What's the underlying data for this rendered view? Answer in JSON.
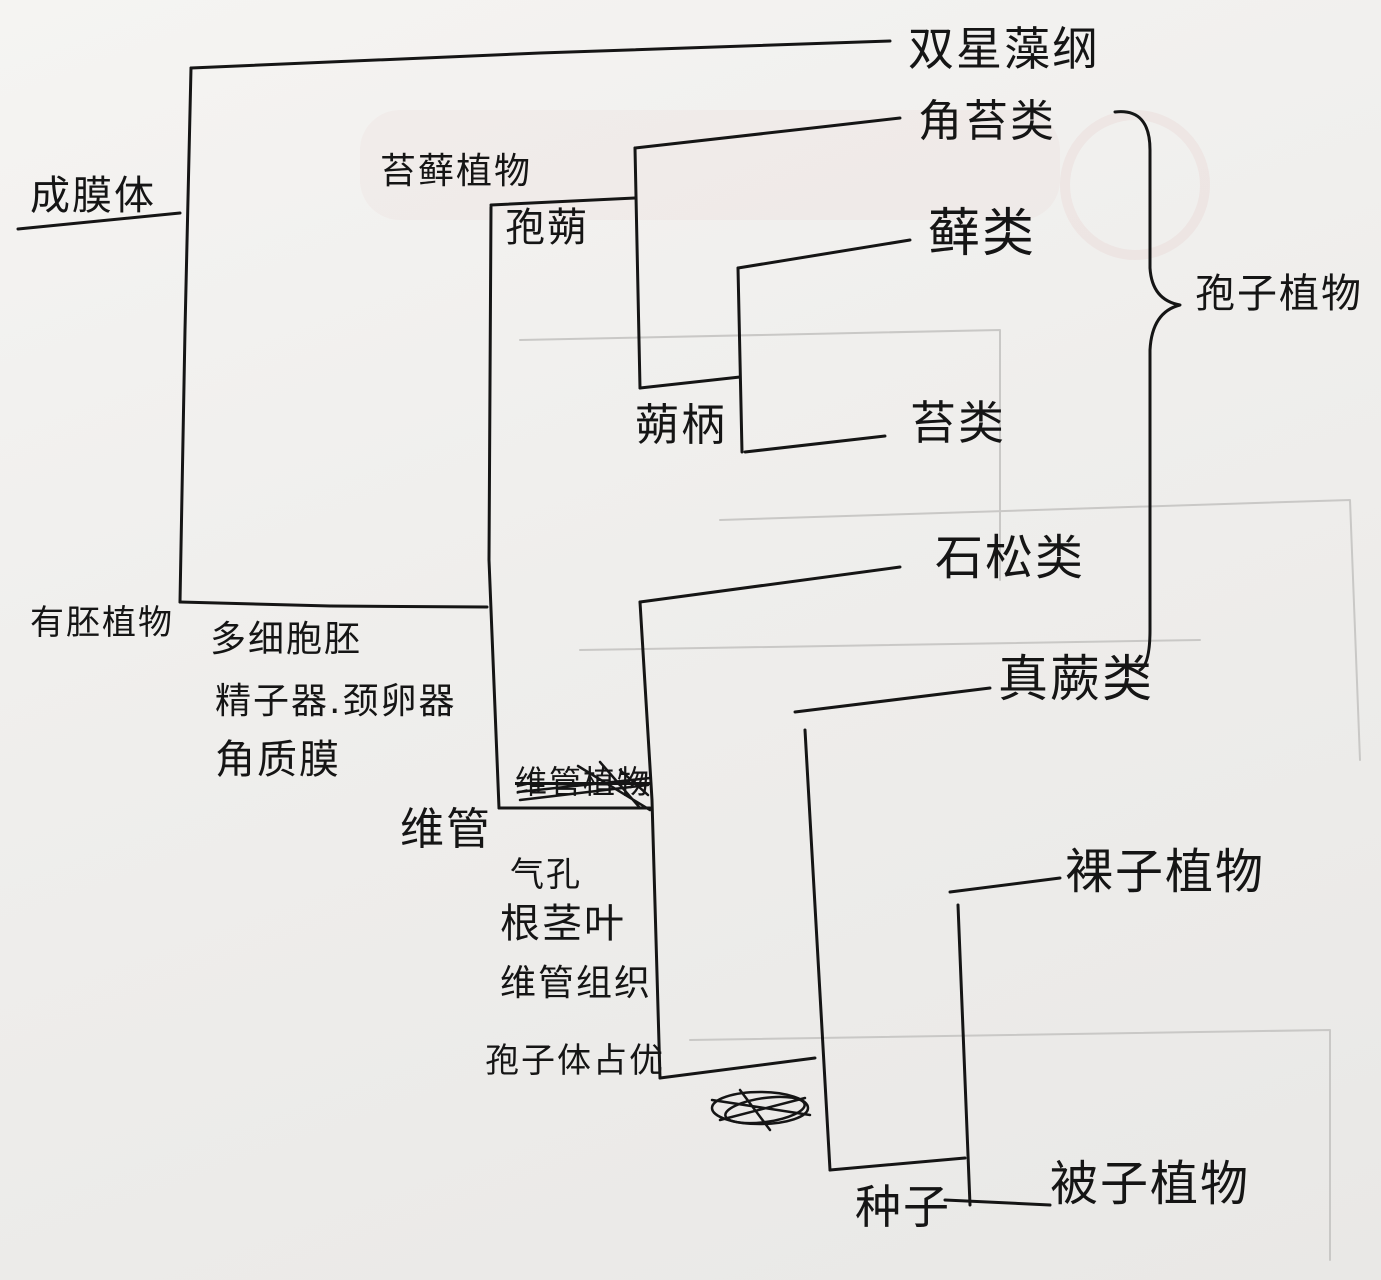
{
  "colors": {
    "ink": "#151515",
    "paper": "#efeeec"
  },
  "taxa": {
    "root": "成膜体",
    "outgroup": "双星藻纲",
    "embryophytes": "有胚植物",
    "bryophytes": "苔藓植物",
    "hornworts": "角苔类",
    "mosses": "藓类",
    "liverworts": "苔类",
    "lycophytes": "石松类",
    "ferns": "真蕨类",
    "gymnosperms": "裸子植物",
    "angiosperms": "被子植物",
    "spore_plants": "孢子植物"
  },
  "traits": {
    "embryophyte": [
      "多细胞胚",
      "精子器.颈卵器",
      "角质膜"
    ],
    "capsule": "孢蒴",
    "seta": "蒴柄",
    "vascular_struck": "维管植物",
    "vascular_label": "维管",
    "vascular": [
      "气孔",
      "根茎叶",
      "维管组织",
      "孢子体占优"
    ],
    "seed": "种子"
  }
}
